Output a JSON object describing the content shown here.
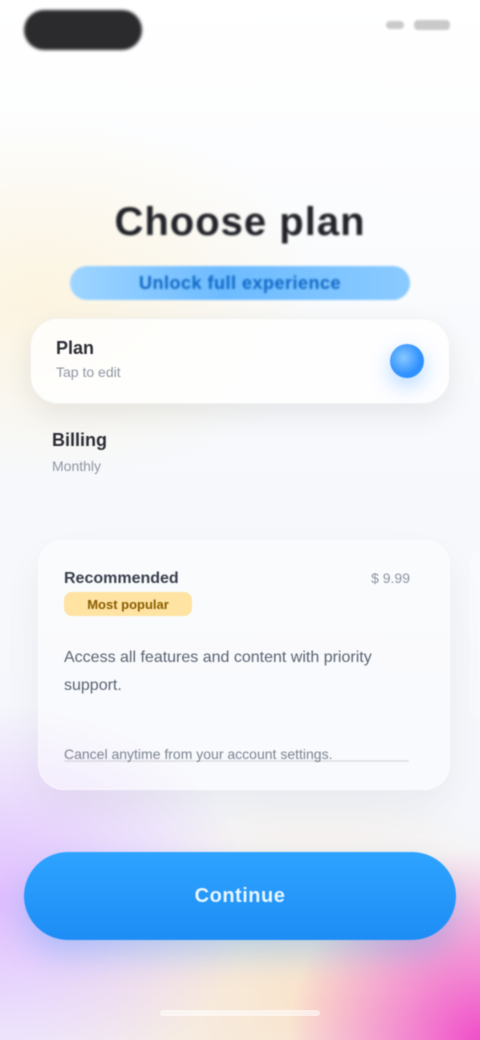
{
  "status": {
    "left_pill_label": "",
    "right_icons": [
      "signal-icon",
      "battery-icon"
    ]
  },
  "header": {
    "title": "Choose plan",
    "subtitle": "Unlock full experience"
  },
  "input": {
    "label": "Plan",
    "hint": "Tap to edit"
  },
  "section": {
    "title": "Billing",
    "hint": "Monthly"
  },
  "plan": {
    "name": "Recommended",
    "price": "$ 9.99",
    "badge": "Most popular",
    "description": "Access all features and content with priority support.",
    "footnote": "Cancel anytime from your account settings."
  },
  "cta": {
    "label": "Continue"
  }
}
